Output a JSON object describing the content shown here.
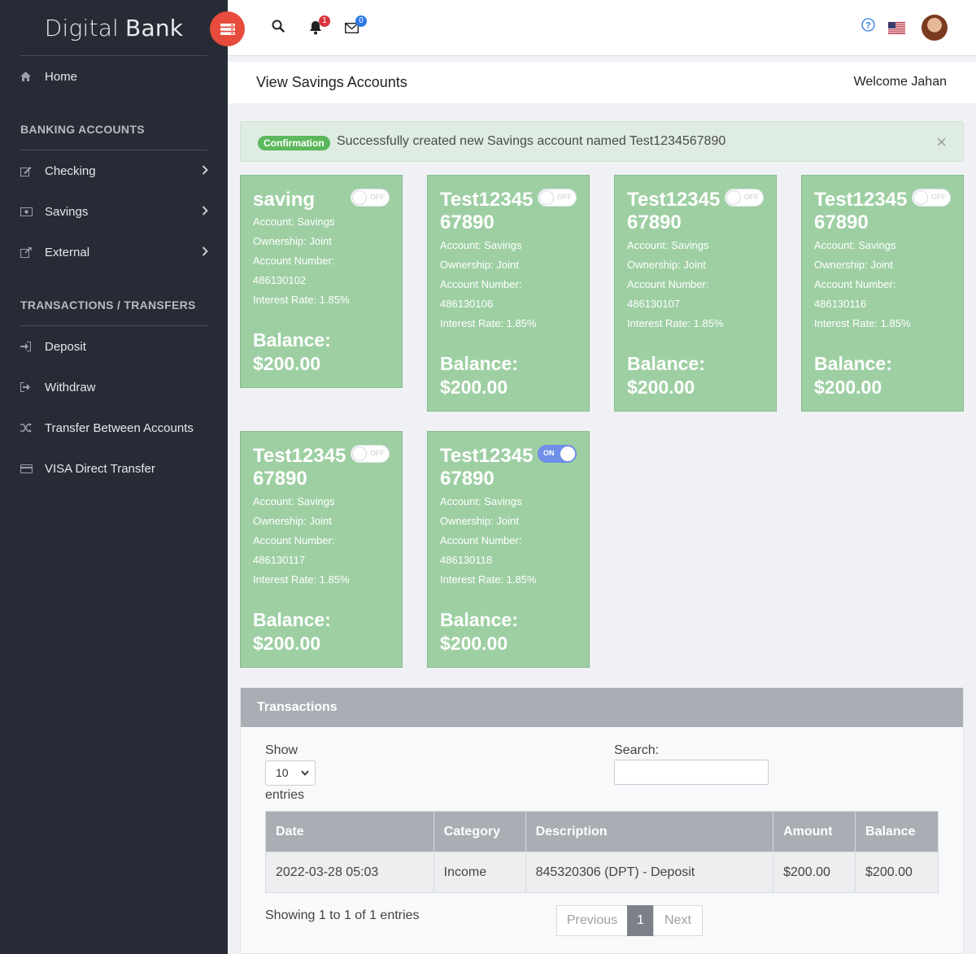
{
  "brand": {
    "light": "Digital",
    "bold": "Bank"
  },
  "sidebar": {
    "home": "Home",
    "section_accounts": "BANKING ACCOUNTS",
    "checking": "Checking",
    "savings": "Savings",
    "external": "External",
    "section_transactions": "TRANSACTIONS / TRANSFERS",
    "deposit": "Deposit",
    "withdraw": "Withdraw",
    "transfer": "Transfer Between Accounts",
    "visa": "VISA Direct Transfer"
  },
  "topbar": {
    "notifications_count": "1",
    "messages_count": "0"
  },
  "header": {
    "title": "View Savings Accounts",
    "welcome": "Welcome Jahan"
  },
  "alert": {
    "label": "Confirmation",
    "message": "Successfully created new Savings account named Test1234567890",
    "close": "×"
  },
  "accounts": [
    {
      "name": "saving",
      "account": "Account: Savings",
      "ownership": "Ownership: Joint",
      "number_label": "Account Number:",
      "number": "486130102",
      "rate": "Interest Rate: 1.85%",
      "balance_label": "Balance:",
      "balance": "$200.00",
      "toggle": "OFF"
    },
    {
      "name": "Test1234567890",
      "account": "Account: Savings",
      "ownership": "Ownership: Joint",
      "number_label": "Account Number:",
      "number": "486130106",
      "rate": "Interest Rate: 1.85%",
      "balance_label": "Balance:",
      "balance": "$200.00",
      "toggle": "OFF"
    },
    {
      "name": "Test1234567890",
      "account": "Account: Savings",
      "ownership": "Ownership: Joint",
      "number_label": "Account Number:",
      "number": "486130107",
      "rate": "Interest Rate: 1.85%",
      "balance_label": "Balance:",
      "balance": "$200.00",
      "toggle": "OFF"
    },
    {
      "name": "Test1234567890",
      "account": "Account: Savings",
      "ownership": "Ownership: Joint",
      "number_label": "Account Number:",
      "number": "486130116",
      "rate": "Interest Rate: 1.85%",
      "balance_label": "Balance:",
      "balance": "$200.00",
      "toggle": "OFF"
    },
    {
      "name": "Test1234567890",
      "account": "Account: Savings",
      "ownership": "Ownership: Joint",
      "number_label": "Account Number:",
      "number": "486130117",
      "rate": "Interest Rate: 1.85%",
      "balance_label": "Balance:",
      "balance": "$200.00",
      "toggle": "OFF"
    },
    {
      "name": "Test1234567890",
      "account": "Account: Savings",
      "ownership": "Ownership: Joint",
      "number_label": "Account Number:",
      "number": "486130118",
      "rate": "Interest Rate: 1.85%",
      "balance_label": "Balance:",
      "balance": "$200.00",
      "toggle": "ON"
    }
  ],
  "transactions": {
    "title": "Transactions",
    "show_label": "Show",
    "entries_label": "entries",
    "page_length": "10",
    "search_label": "Search:",
    "columns": [
      "Date",
      "Category",
      "Description",
      "Amount",
      "Balance"
    ],
    "rows": [
      [
        "2022-03-28 05:03",
        "Income",
        "845320306 (DPT) - Deposit",
        "$200.00",
        "$200.00"
      ]
    ],
    "info": "Showing 1 to 1 of 1 entries",
    "prev": "Previous",
    "page": "1",
    "next": "Next"
  },
  "colors": {
    "sidebar": "#272b35",
    "card": "#9ecfa3",
    "menu_button": "#e64b3c",
    "toggle_on": "#6e8ee8"
  }
}
